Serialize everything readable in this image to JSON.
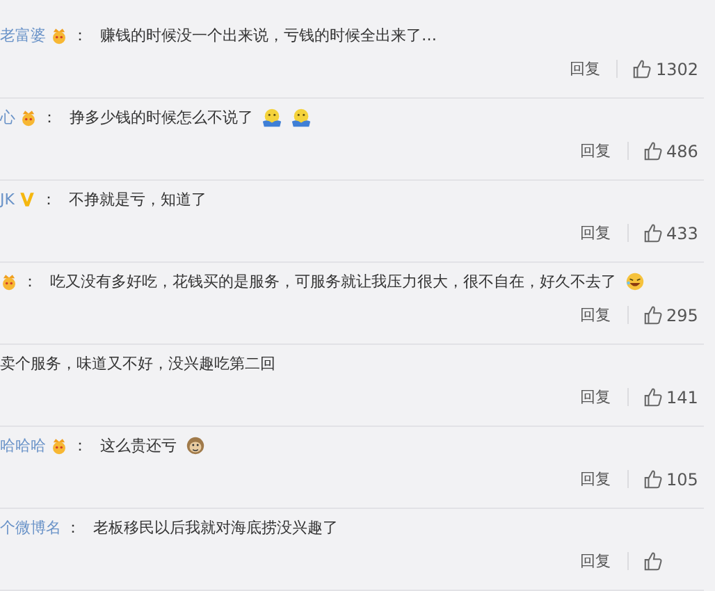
{
  "comments": [
    {
      "user": "老富婆",
      "badge": {
        "kind": "crown"
      },
      "separator": "：",
      "text": "赚钱的时候没一个出来说，亏钱的时候全出来了…",
      "reply": "回复",
      "likes": "1302"
    },
    {
      "user": "心",
      "badge": {
        "kind": "crown"
      },
      "separator": "：",
      "text": "挣多少钱的时候怎么不说了",
      "emojis": [
        {
          "kind": "hug"
        },
        {
          "kind": "hug"
        }
      ],
      "reply": "回复",
      "likes": "486"
    },
    {
      "user": "JK",
      "badge": {
        "kind": "verified"
      },
      "separator": "：",
      "text": "不挣就是亏，知道了",
      "reply": "回复",
      "likes": "433"
    },
    {
      "badge": {
        "kind": "crown"
      },
      "separator": "：",
      "text": "吃又没有多好吃，花钱买的是服务，可服务就让我压力很大，很不自在，好久不去了",
      "emojis": [
        {
          "kind": "laugh"
        }
      ],
      "reply": "回复",
      "likes": "295"
    },
    {
      "text": "卖个服务，味道又不好，没兴趣吃第二回",
      "reply": "回复",
      "likes": "141"
    },
    {
      "user": "哈哈哈",
      "badge": {
        "kind": "crown"
      },
      "separator": "：",
      "text": "这么贵还亏",
      "emojis": [
        {
          "kind": "monkey"
        }
      ],
      "reply": "回复",
      "likes": "105"
    },
    {
      "user": "个微博名",
      "separator": "：",
      "text": "老板移民以后我就对海底捞没兴趣了",
      "reply": "回复"
    }
  ]
}
